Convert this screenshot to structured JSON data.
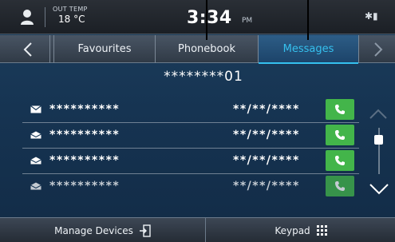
{
  "status": {
    "temp_label": "OUT TEMP",
    "temp_value": "18 °C",
    "clock": "3:34",
    "ampm": "PM"
  },
  "tabs": {
    "favourites": "Favourites",
    "phonebook": "Phonebook",
    "messages": "Messages",
    "active": "Messages"
  },
  "contact_number": "********01",
  "messages": [
    {
      "icon": "envelope-closed-icon",
      "name": "**********",
      "date": "**/**/****"
    },
    {
      "icon": "envelope-open-icon",
      "name": "**********",
      "date": "**/**/****"
    },
    {
      "icon": "envelope-open-icon",
      "name": "**********",
      "date": "**/**/****"
    },
    {
      "icon": "envelope-open-icon",
      "name": "**********",
      "date": "**/**/****"
    }
  ],
  "bottom": {
    "manage_devices": "Manage Devices",
    "keypad": "Keypad"
  },
  "colors": {
    "accent": "#35c0ee",
    "call_green": "#43b54a",
    "background": "#163452"
  }
}
